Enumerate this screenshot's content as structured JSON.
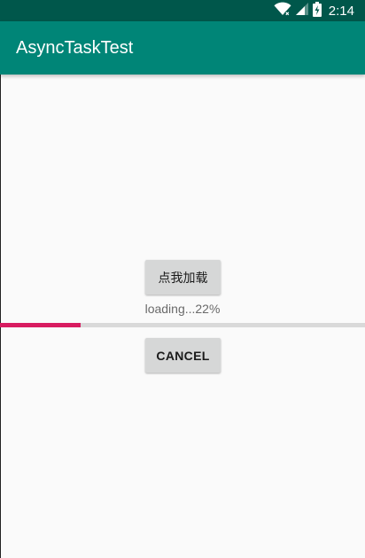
{
  "status_bar": {
    "time": "2:14",
    "icons": [
      "wifi-icon",
      "signal-icon",
      "battery-charging-icon"
    ]
  },
  "app_bar": {
    "title": "AsyncTaskTest"
  },
  "main": {
    "load_button_label": "点我加载",
    "loading_text": "loading...22%",
    "progress_value": 0.22,
    "cancel_button_label": "CANCEL"
  },
  "colors": {
    "status_bar": "#00574b",
    "primary": "#008577",
    "accent": "#d81b60",
    "background": "#fafafa",
    "button": "#d6d7d7"
  }
}
